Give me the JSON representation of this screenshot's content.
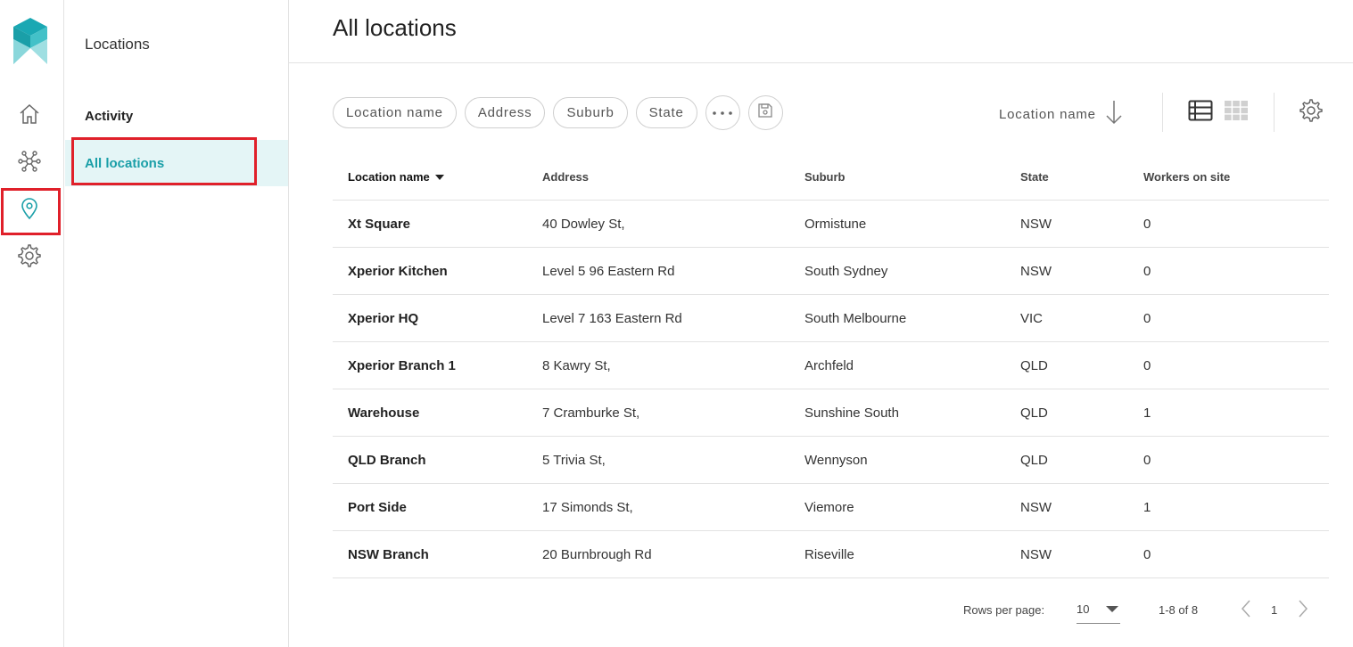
{
  "nav": {
    "items": [
      {
        "name": "home",
        "icon": "home-icon"
      },
      {
        "name": "network",
        "icon": "network-icon"
      },
      {
        "name": "locations",
        "icon": "location-pin-icon",
        "active": true
      },
      {
        "name": "settings",
        "icon": "gear-icon"
      }
    ]
  },
  "subnav": {
    "title": "Locations",
    "items": [
      {
        "label": "Activity",
        "active": false
      },
      {
        "label": "All locations",
        "active": true
      }
    ]
  },
  "page": {
    "title": "All locations"
  },
  "filters": {
    "chips": [
      "Location name",
      "Address",
      "Suburb",
      "State"
    ],
    "more_icon": "more-horizontal-icon",
    "save_icon": "save-icon"
  },
  "sort": {
    "label": "Location name",
    "direction_icon": "arrow-down-icon"
  },
  "views": {
    "list_icon": "list-view-icon",
    "grid_icon": "grid-view-icon",
    "active": "list"
  },
  "table": {
    "columns": [
      "Location name",
      "Address",
      "Suburb",
      "State",
      "Workers on site"
    ],
    "rows": [
      [
        "Xt Square",
        "40 Dowley St,",
        "Ormistune",
        "NSW",
        "0"
      ],
      [
        "Xperior Kitchen",
        "Level 5 96 Eastern Rd",
        "South Sydney",
        "NSW",
        "0"
      ],
      [
        "Xperior HQ",
        "Level 7 163 Eastern Rd",
        "South Melbourne",
        "VIC",
        "0"
      ],
      [
        "Xperior Branch 1",
        "8 Kawry St,",
        "Archfeld",
        "QLD",
        "0"
      ],
      [
        "Warehouse",
        "7 Cramburke St,",
        "Sunshine South",
        "QLD",
        "1"
      ],
      [
        "QLD Branch",
        "5 Trivia St,",
        "Wennyson",
        "QLD",
        "0"
      ],
      [
        "Port Side",
        "17 Simonds St,",
        "Viemore",
        "NSW",
        "1"
      ],
      [
        "NSW Branch",
        "20 Burnbrough Rd",
        "Riseville",
        "NSW",
        "0"
      ]
    ]
  },
  "pagination": {
    "rows_per_page_label": "Rows per page:",
    "rows_per_page": "10",
    "range": "1-8 of 8",
    "page": "1"
  },
  "colors": {
    "accent": "#1a9fa8",
    "accent_bg": "#e4f5f6",
    "highlight": "#e0202a"
  }
}
